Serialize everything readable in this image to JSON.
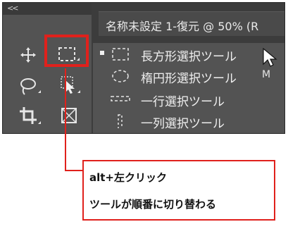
{
  "toolbar": {
    "collapse_glyph": "<<",
    "tools": [
      {
        "name": "move-tool",
        "icon": "move-icon"
      },
      {
        "name": "marquee-tool",
        "icon": "rectangular-marquee-icon"
      },
      {
        "name": "lasso-tool",
        "icon": "lasso-icon"
      },
      {
        "name": "object-select-tool",
        "icon": "object-select-icon"
      },
      {
        "name": "crop-tool",
        "icon": "crop-icon"
      },
      {
        "name": "frame-tool",
        "icon": "frame-icon"
      }
    ]
  },
  "document": {
    "tab_title": "名称未設定 1-復元 @ 50% (R"
  },
  "flyout_menu": {
    "items": [
      {
        "label": "長方形選択ツール",
        "shortcut": "M",
        "active": true,
        "icon": "rectangular-marquee-icon"
      },
      {
        "label": "楕円形選択ツール",
        "shortcut": "M",
        "active": false,
        "icon": "elliptical-marquee-icon"
      },
      {
        "label": "一行選択ツール",
        "shortcut": "",
        "active": false,
        "icon": "single-row-marquee-icon"
      },
      {
        "label": "一列選択ツール",
        "shortcut": "",
        "active": false,
        "icon": "single-column-marquee-icon"
      }
    ]
  },
  "callout": {
    "line1": "alt+左クリック",
    "line2": "ツールが順番に切り替わる"
  },
  "colors": {
    "highlight": "#e0211c",
    "toolbar_bg": "#535353",
    "panel_dark": "#3c3c3c"
  }
}
